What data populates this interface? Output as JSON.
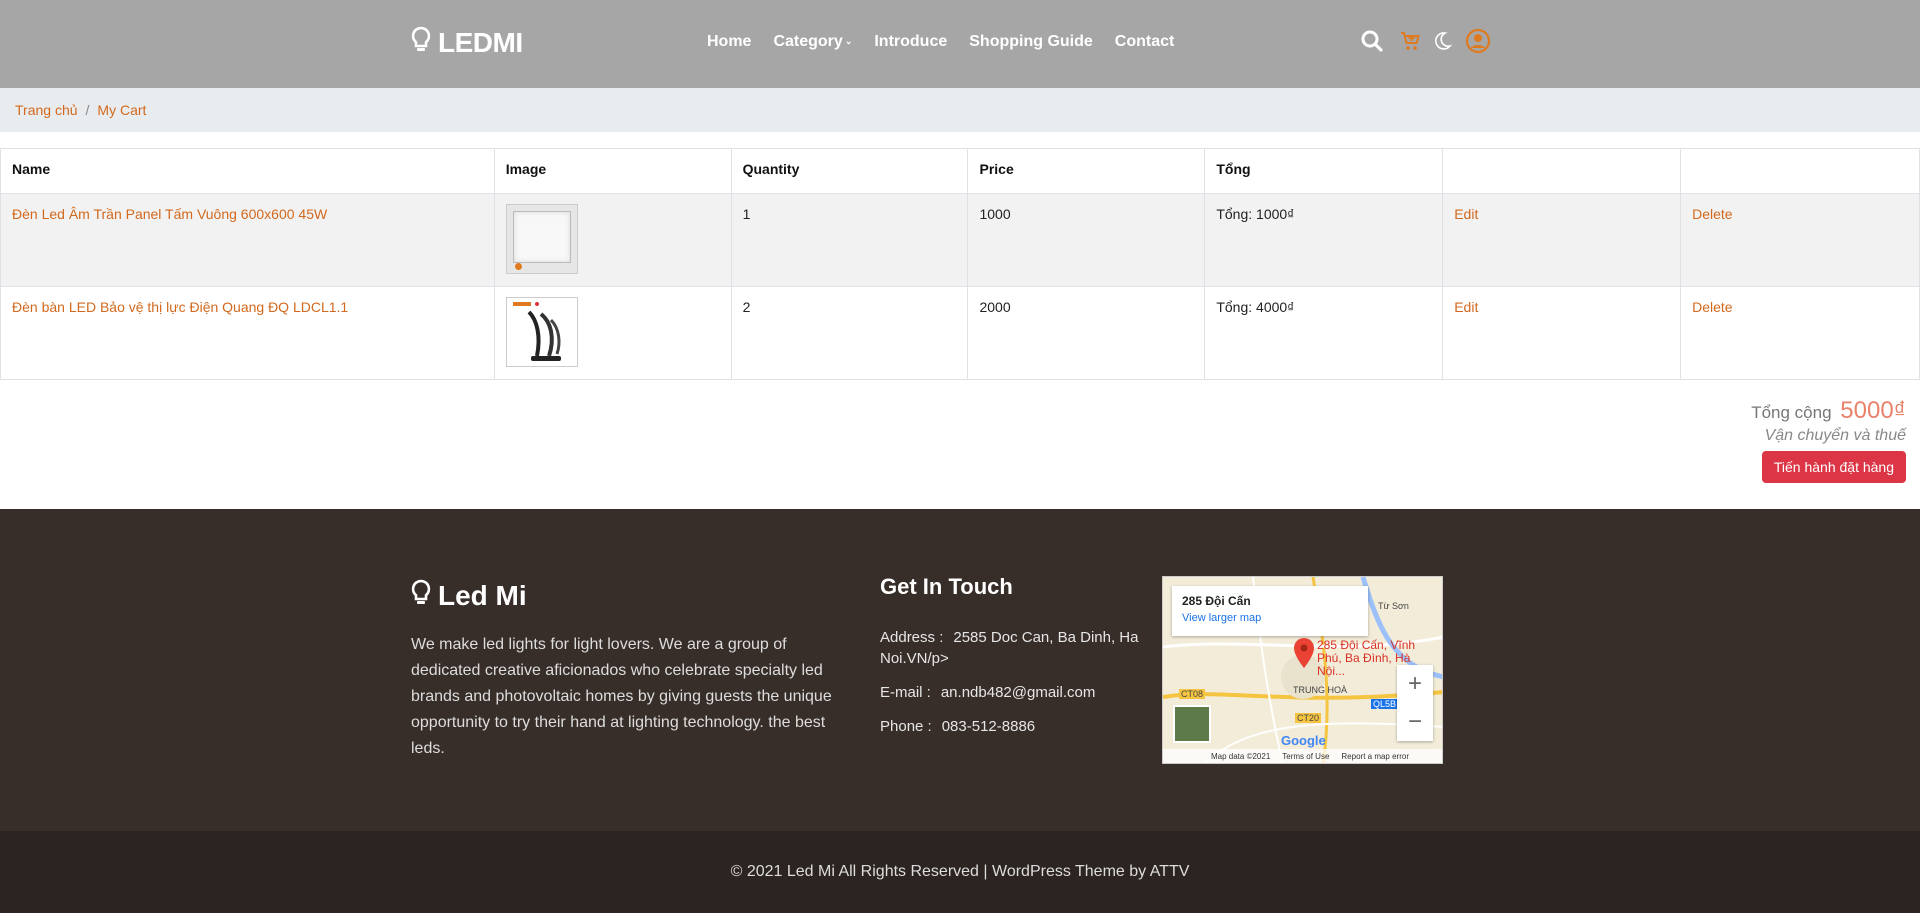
{
  "header": {
    "logo": "LEDMI",
    "nav": [
      {
        "label": "Home"
      },
      {
        "label": "Category"
      },
      {
        "label": "Introduce"
      },
      {
        "label": "Shopping Guide"
      },
      {
        "label": "Contact"
      }
    ],
    "icons": [
      "search-icon",
      "cart-icon",
      "moon-icon",
      "user-icon"
    ],
    "icon_color": "#e07a1f"
  },
  "breadcrumb": {
    "home": "Trang chủ",
    "separator": "/",
    "current": "My Cart"
  },
  "cart": {
    "headers": {
      "name": "Name",
      "image": "Image",
      "quantity": "Quantity",
      "price": "Price",
      "total": "Tổng"
    },
    "items": [
      {
        "name": "Đèn Led Âm Trần Panel Tấm Vuông 600x600 45W",
        "quantity": "1",
        "price": "1000",
        "total": "Tổng: 1000₫",
        "edit": "Edit",
        "delete": "Delete"
      },
      {
        "name": "Đèn bàn LED Bảo vệ thị lực Điện Quang ĐQ LDCL1.1",
        "quantity": "2",
        "price": "2000",
        "total": "Tổng: 4000₫",
        "edit": "Edit",
        "delete": "Delete"
      }
    ],
    "grand_total_label": "Tổng cộng",
    "grand_total_value": "5000₫",
    "tax_note": "Vận chuyển và thuế",
    "checkout_label": "Tiến hành đặt hàng"
  },
  "footer": {
    "brand": "Led Mi",
    "description": "We make led lights for light lovers. We are a group of dedicated creative aficionados who celebrate specialty led brands and photovoltaic homes by giving guests the unique opportunity to try their hand at lighting technology. the best leds.",
    "contact_heading": "Get In Touch",
    "address_label": "Address :",
    "address_value": "2585 Doc Can, Ba Dinh, Ha Noi.VN/p>",
    "email_label": "E-mail :",
    "email_value": "an.ndb482@gmail.com",
    "phone_label": "Phone :",
    "phone_value": "083-512-8886",
    "map": {
      "place": "285 Đội Cấn",
      "view_larger": "View larger map",
      "pin_label": "285 Đội Cấn, Vĩnh Phú, Ba Đình, Hà Nội...",
      "labels": [
        "Từ Sơn",
        "TRUNG HOÀ",
        "CT08",
        "CT20",
        "QL5B"
      ],
      "google": "Google",
      "attribution": [
        "Map data ©2021",
        "Terms of Use",
        "Report a map error"
      ]
    },
    "copyright": "© 2021 Led Mi All Rights Reserved | WordPress Theme by ATTV"
  }
}
